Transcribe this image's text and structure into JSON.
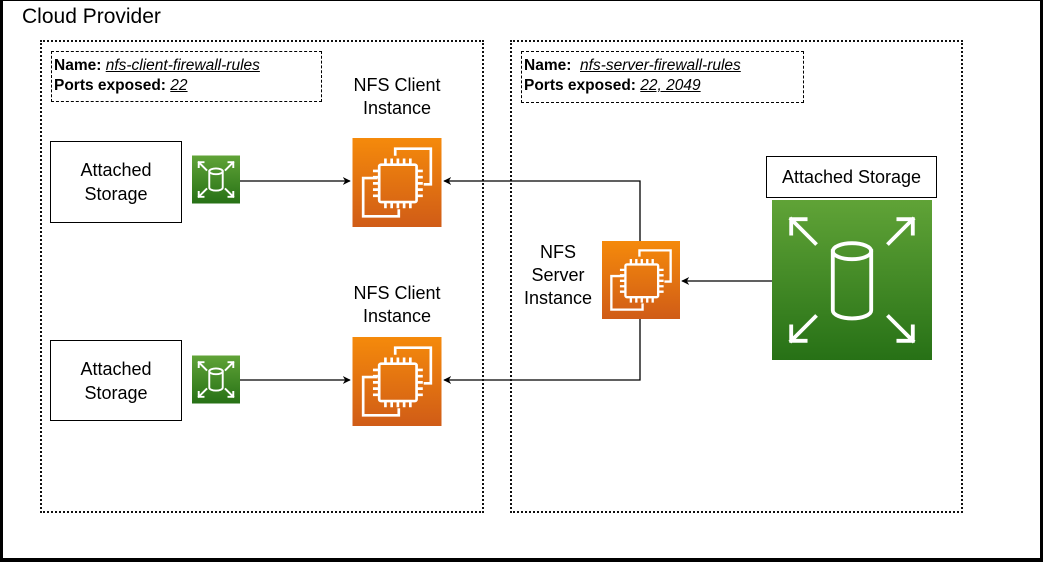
{
  "diagram": {
    "title": "Cloud Provider",
    "client_zone": {
      "firewall": {
        "name_label": "Name:",
        "name_value": "nfs-client-firewall-rules",
        "ports_label": "Ports exposed:",
        "ports_value": "22"
      },
      "clients": [
        {
          "instance_label_line1": "NFS Client",
          "instance_label_line2": "Instance",
          "instance_icon": "ec2-instance-icon",
          "storage_label_line1": "Attached",
          "storage_label_line2": "Storage",
          "storage_icon": "elastic-block-store-icon"
        },
        {
          "instance_label_line1": "NFS Client",
          "instance_label_line2": "Instance",
          "instance_icon": "ec2-instance-icon",
          "storage_label_line1": "Attached",
          "storage_label_line2": "Storage",
          "storage_icon": "elastic-block-store-icon"
        }
      ]
    },
    "server_zone": {
      "firewall": {
        "name_label": "Name:",
        "name_value": "nfs-server-firewall-rules",
        "ports_label": "Ports exposed:",
        "ports_value": "22, 2049"
      },
      "server": {
        "label_line1": "NFS",
        "label_line2": "Server",
        "label_line3": "Instance",
        "icon": "ec2-instance-icon"
      },
      "storage": {
        "label": "Attached Storage",
        "icon": "elastic-block-store-icon"
      }
    },
    "colors": {
      "compute_orange_top": "#F58A0B",
      "compute_orange_bottom": "#D05C17",
      "storage_green_top": "#60A337",
      "storage_green_bottom": "#277116",
      "line": "#000000"
    },
    "connections": [
      {
        "from": "client-1-storage",
        "to": "nfs-client-1"
      },
      {
        "from": "client-2-storage",
        "to": "nfs-client-2"
      },
      {
        "from": "nfs-server",
        "to": "nfs-client-1"
      },
      {
        "from": "nfs-server",
        "to": "nfs-client-2"
      },
      {
        "from": "server-storage",
        "to": "nfs-server"
      }
    ]
  }
}
